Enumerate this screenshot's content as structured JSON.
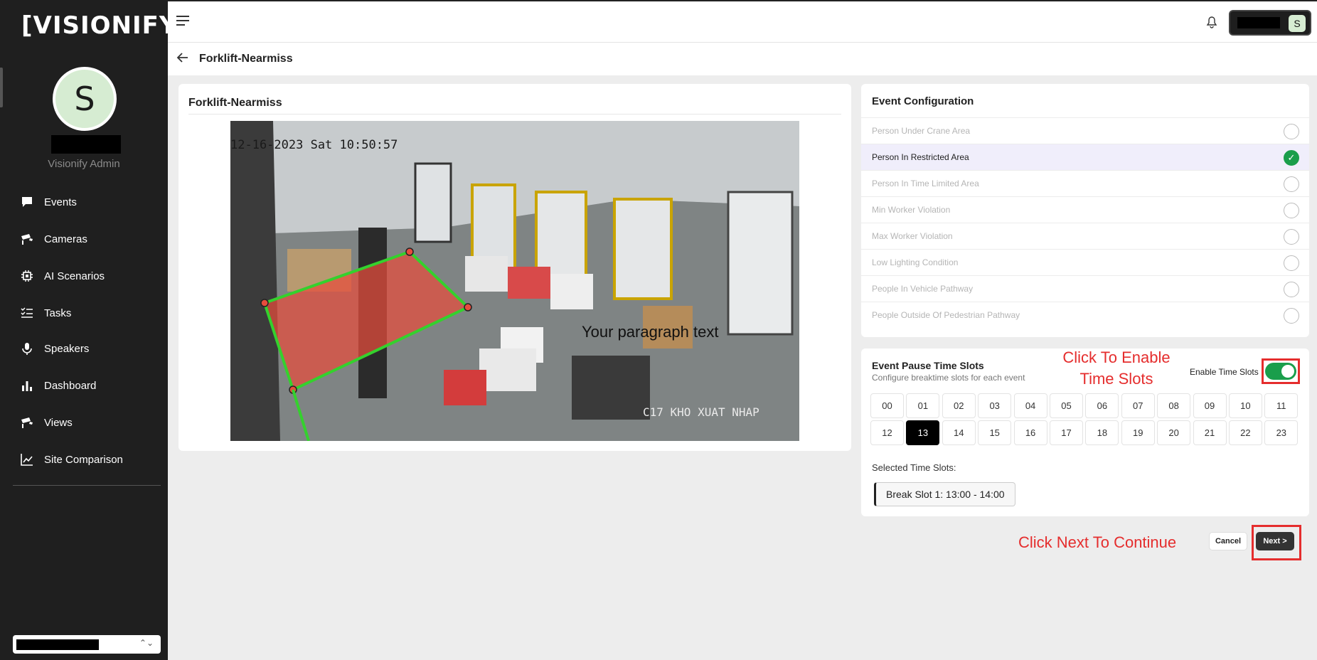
{
  "app": {
    "logo_text": "[VISIONIFY]"
  },
  "user": {
    "avatar_initial": "S",
    "role": "Visionify Admin"
  },
  "sidebar": {
    "items": [
      {
        "label": "Events",
        "icon": "chat-bubble-icon"
      },
      {
        "label": "Cameras",
        "icon": "cctv-camera-icon"
      },
      {
        "label": "AI Scenarios",
        "icon": "chip-icon"
      },
      {
        "label": "Tasks",
        "icon": "task-list-icon"
      },
      {
        "label": "Speakers",
        "icon": "microphone-icon"
      },
      {
        "label": "Dashboard",
        "icon": "bar-chart-icon"
      },
      {
        "label": "Views",
        "icon": "cctv-camera-icon"
      },
      {
        "label": "Site Comparison",
        "icon": "line-chart-icon"
      }
    ]
  },
  "topbar": {
    "avatar_initial": "S"
  },
  "page": {
    "title": "Forklift-Nearmiss"
  },
  "camera": {
    "card_title": "Forklift-Nearmiss",
    "timestamp": "12-16-2023 Sat 10:50:57",
    "location_overlay": "C17 KHO XUAT NHAP",
    "paragraph_overlay": "Your paragraph text",
    "zone_color": "#e74c3c",
    "zone_border_color": "#34d12d"
  },
  "event_config": {
    "title": "Event Configuration",
    "items": [
      {
        "label": "Person Under Crane Area",
        "selected": false
      },
      {
        "label": "Person In Restricted Area",
        "selected": true
      },
      {
        "label": "Person In Time Limited Area",
        "selected": false
      },
      {
        "label": "Min Worker Violation",
        "selected": false
      },
      {
        "label": "Max Worker Violation",
        "selected": false
      },
      {
        "label": "Low Lighting Condition",
        "selected": false
      },
      {
        "label": "People In Vehicle Pathway",
        "selected": false
      },
      {
        "label": "People Outside Of Pedestrian Pathway",
        "selected": false
      }
    ]
  },
  "time_slots": {
    "title": "Event Pause Time Slots",
    "subtitle": "Configure breaktime slots for each event",
    "enable_label": "Enable Time Slots",
    "enabled": true,
    "hours": [
      "00",
      "01",
      "02",
      "03",
      "04",
      "05",
      "06",
      "07",
      "08",
      "09",
      "10",
      "11",
      "12",
      "13",
      "14",
      "15",
      "16",
      "17",
      "18",
      "19",
      "20",
      "21",
      "22",
      "23"
    ],
    "selected_hour": "13",
    "selected_label": "Selected Time Slots:",
    "break_slots": [
      "Break Slot 1: 13:00 - 14:00"
    ]
  },
  "actions": {
    "cancel_label": "Cancel",
    "next_label": "Next >"
  },
  "annotations": {
    "enable_line1": "Click To Enable",
    "enable_line2": "Time Slots",
    "next": "Click Next To Continue",
    "color": "#e52d2d"
  }
}
